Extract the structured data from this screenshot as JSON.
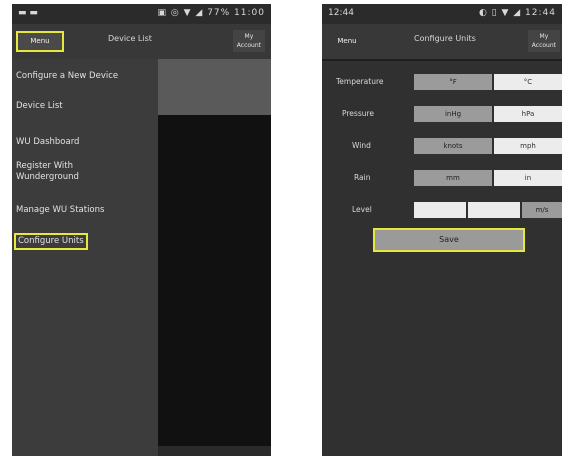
{
  "left": {
    "status": {
      "time": "",
      "icons": "▣ ◎ ▼ ◢ 77% 11:00"
    },
    "appbar": {
      "menu_label": "Menu",
      "title": "Device List",
      "right_label_1": "My",
      "right_label_2": "Account"
    },
    "drawer": {
      "items": [
        "Configure a New Device",
        "Device List",
        "WU Dashboard",
        "Register With",
        "Wunderground",
        "Manage WU Stations",
        "Configure Units"
      ]
    }
  },
  "right": {
    "status": {
      "time": "12:44",
      "icons": "◐ ▯ ▼ ◢ 12:44"
    },
    "appbar": {
      "left_label": "Menu",
      "title": "Configure Units",
      "right_label_1": "My",
      "right_label_2": "Account"
    },
    "rows": [
      {
        "label": "Temperature",
        "options": [
          "°F",
          "°C"
        ],
        "selected": 0
      },
      {
        "label": "Pressure",
        "options": [
          "inHg",
          "hPa"
        ],
        "selected": 0
      },
      {
        "label": "Wind",
        "options": [
          "knots",
          "mph"
        ],
        "selected": 0
      },
      {
        "label": "Rain",
        "options": [
          "mm",
          "in"
        ],
        "selected": 0
      },
      {
        "label": "Level",
        "options": [
          "",
          "",
          "m/s"
        ],
        "selected": 2
      }
    ],
    "save_label": "Save"
  },
  "colors": {
    "highlight": "#e7e83f",
    "background": "#303030"
  }
}
